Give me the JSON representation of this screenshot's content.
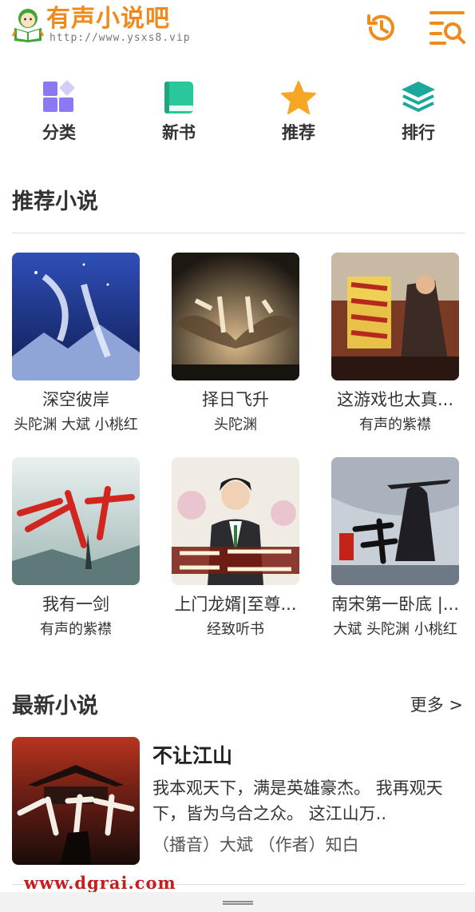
{
  "header": {
    "site_name": "有声小说吧",
    "site_url": "http://www.ysxs8.vip",
    "logo_icon": "reading-child-icon",
    "history_icon": "history-clock-icon",
    "search_icon": "menu-search-icon",
    "brand_color": "#f08a1c"
  },
  "nav": [
    {
      "label": "分类",
      "icon": "category-grid-icon",
      "color": "#8a79f0"
    },
    {
      "label": "新书",
      "icon": "book-icon",
      "color": "#2ac79a"
    },
    {
      "label": "推荐",
      "icon": "star-icon",
      "color": "#f5a623"
    },
    {
      "label": "排行",
      "icon": "layers-icon",
      "color": "#1aa99a"
    }
  ],
  "recommended": {
    "title": "推荐小说",
    "books": [
      {
        "title": "深空彼岸",
        "author": "头陀渊 大斌 小桃红"
      },
      {
        "title": "择日飞升",
        "author": "头陀渊"
      },
      {
        "title": "这游戏也太真...",
        "author": "有声的紫襟"
      },
      {
        "title": "我有一剑",
        "author": "有声的紫襟"
      },
      {
        "title": "上门龙婿|至尊...",
        "author": "经致听书"
      },
      {
        "title": "南宋第一卧底 |...",
        "author": "大斌 头陀渊 小桃红"
      }
    ]
  },
  "latest": {
    "title": "最新小说",
    "more_label": "更多 >",
    "book": {
      "title": "不让江山",
      "description": "我本观天下，满是英雄豪杰。 我再观天下，皆为乌合之众。 这江山万..",
      "meta": "（播音）大斌 （作者）知白"
    }
  },
  "watermark": "www.dgrai.com"
}
